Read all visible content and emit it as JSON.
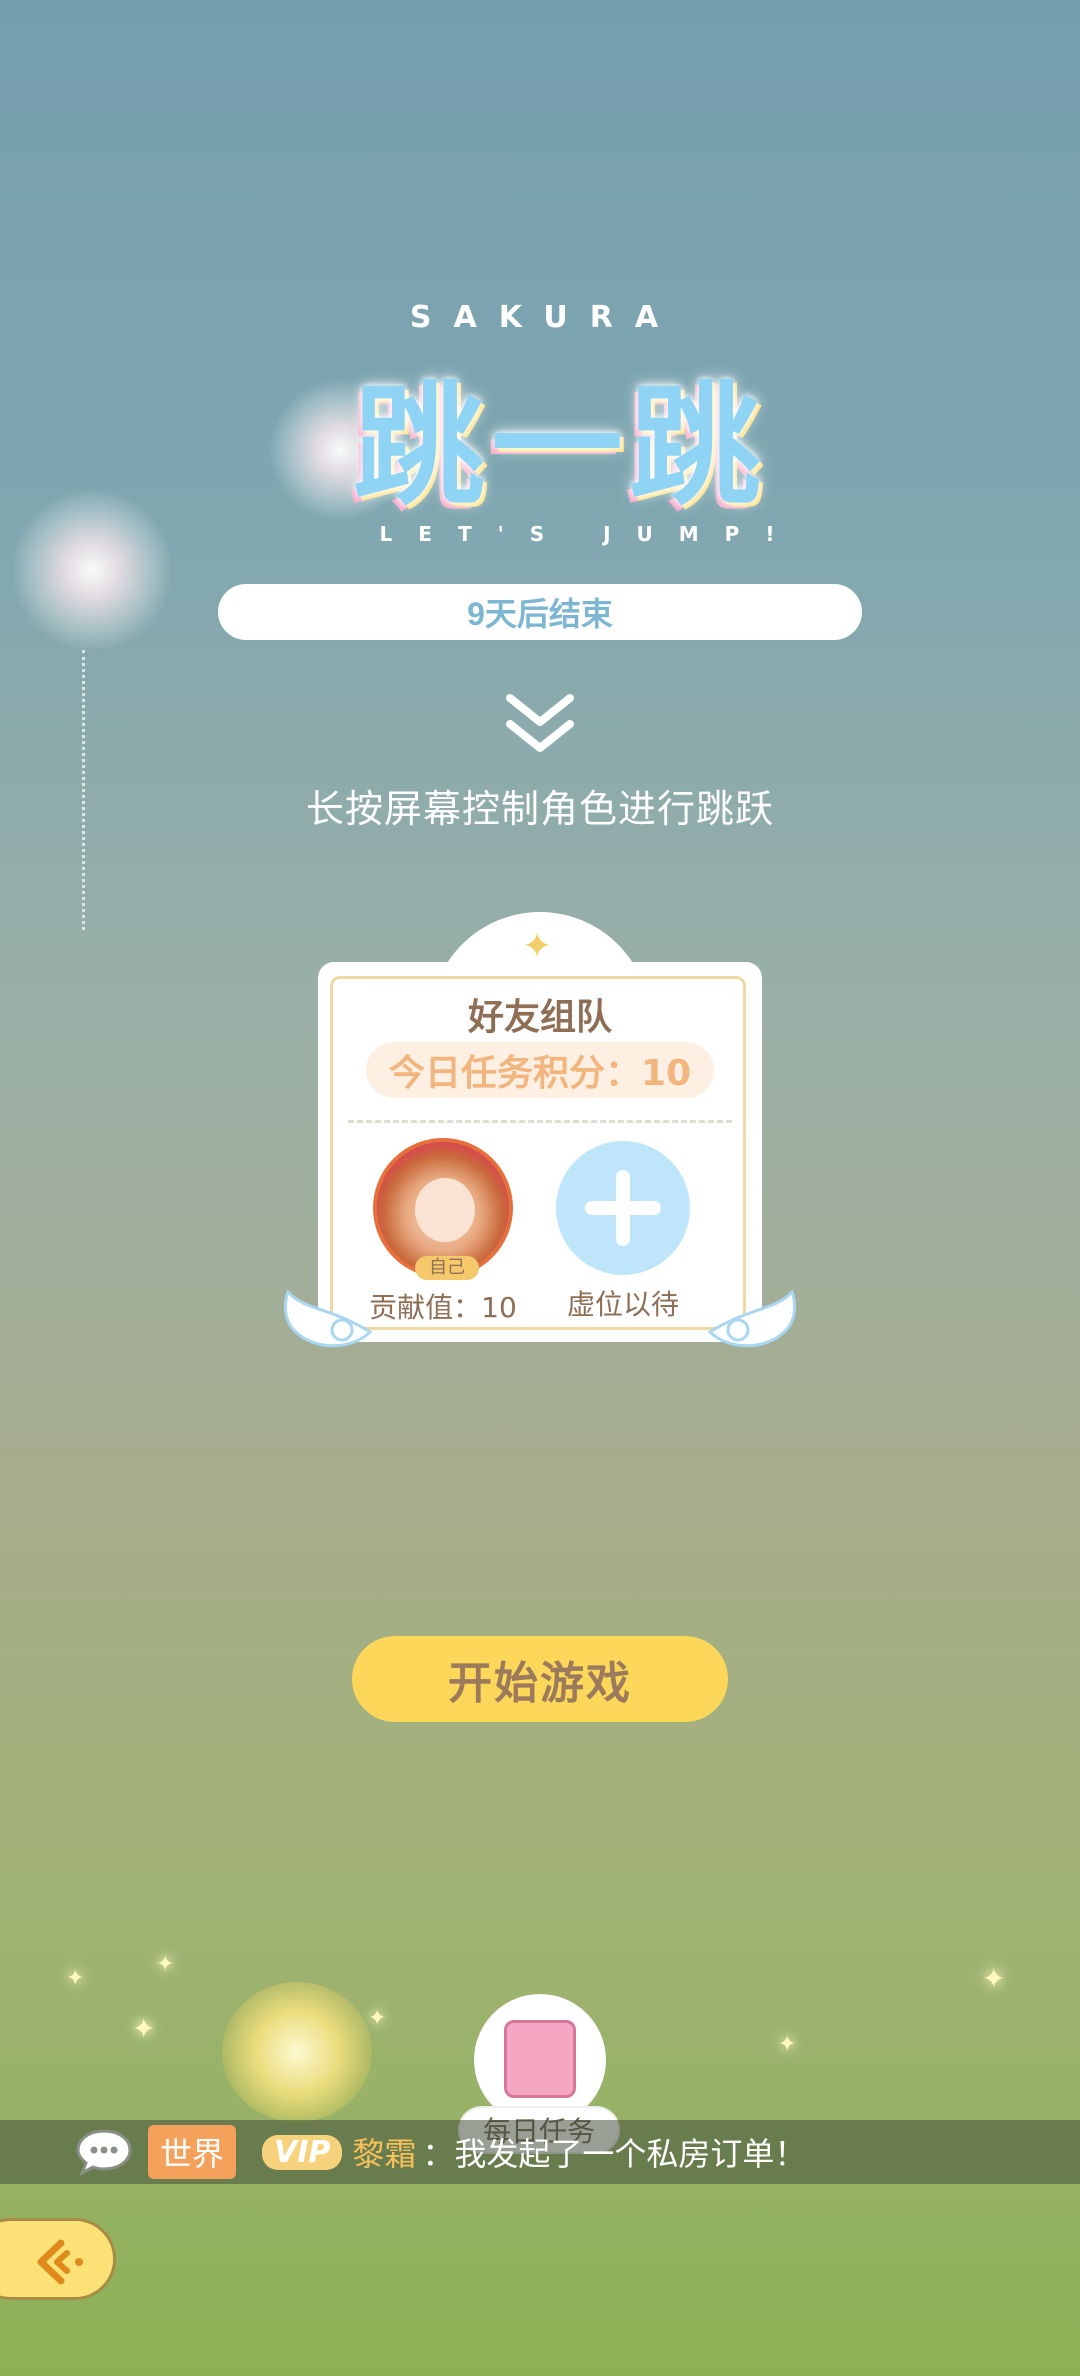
{
  "logo": {
    "top_text": "SAKURA",
    "title": "跳一跳",
    "subtitle": "LET'S JUMP!"
  },
  "countdown": "9天后结束",
  "instruction": "长按屏幕控制角色进行跳跃",
  "team_card": {
    "title": "好友组队",
    "score_text": "今日任务积分：10",
    "slots": [
      {
        "tag": "自己",
        "label": "贡献值：10"
      },
      {
        "label": "虚位以待"
      }
    ]
  },
  "start_button": "开始游戏",
  "daily_task": "每日任务",
  "chat": {
    "channel": "世界",
    "vip": "VIP",
    "user": "黎霜",
    "message": "：我发起了一个私房订单！"
  },
  "colors": {
    "accent_yellow": "#fdd75a",
    "countdown_text": "#7db6d3",
    "card_text": "#8e6f56",
    "score_text": "#f2b57e",
    "add_button": "#bfe5fb"
  }
}
